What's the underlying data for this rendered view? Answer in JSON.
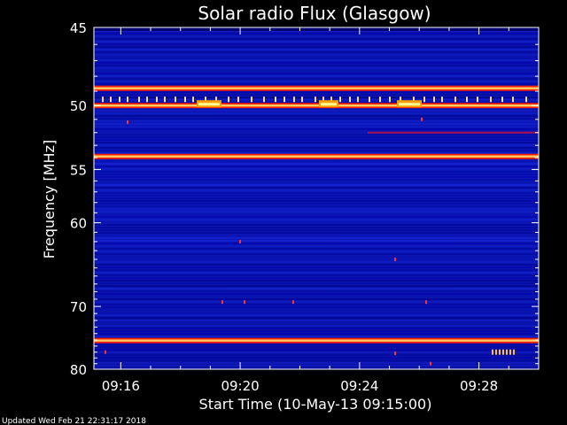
{
  "chart_data": {
    "type": "heatmap",
    "title": "Solar radio Flux (Glasgow)",
    "xlabel": "Start Time (10-May-13 09:15:00)",
    "ylabel": "Frequency [MHz]",
    "x_ticks": [
      "09:16",
      "09:20",
      "09:24",
      "09:28"
    ],
    "x_tick_minutes": [
      1,
      5,
      9,
      13
    ],
    "x_range_minutes": [
      0.1,
      15.0
    ],
    "y_ticks": [
      45,
      50,
      55,
      60,
      70,
      80
    ],
    "ylim": [
      45,
      80
    ],
    "y_scale": "reciprocal",
    "colormap": [
      "#000066",
      "#0000cc",
      "#2233ff",
      "#ff0000",
      "#ffaa00",
      "#ffffaa"
    ],
    "strong_bands_mhz": [
      48.8,
      50.0,
      53.9,
      75.1
    ],
    "background": "#000000",
    "footer": "Updated Wed Feb 21 22:31:17 2018"
  }
}
